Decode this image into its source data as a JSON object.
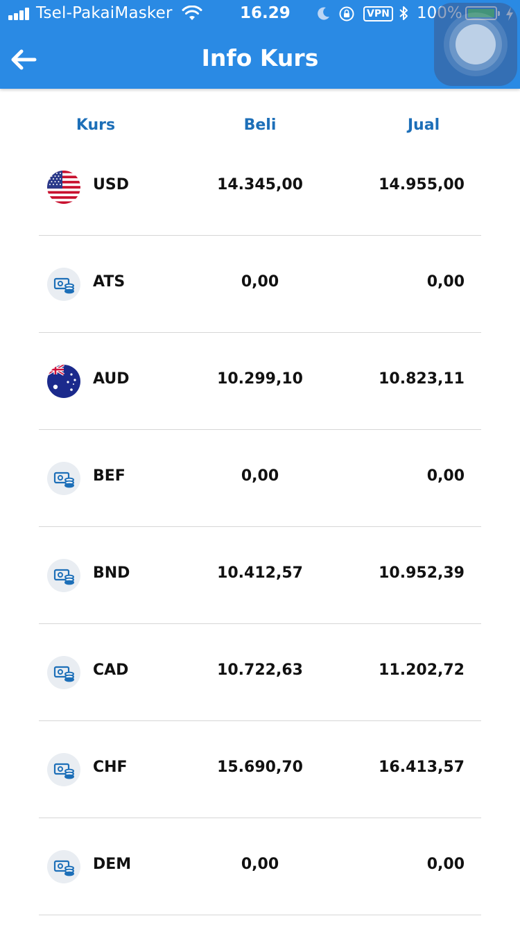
{
  "status_bar": {
    "carrier": "Tsel-PakaiMasker",
    "time": "16.29",
    "vpn_label": "VPN",
    "battery_percent": "100%",
    "battery_level": 1.0
  },
  "nav": {
    "title": "Info Kurs"
  },
  "table": {
    "headers": {
      "kurs": "Kurs",
      "beli": "Beli",
      "jual": "Jual"
    },
    "rows": [
      {
        "code": "USD",
        "beli": "14.345,00",
        "jual": "14.955,00",
        "icon": "us-flag-icon"
      },
      {
        "code": "ATS",
        "beli": "0,00",
        "jual": "0,00",
        "icon": "money-icon"
      },
      {
        "code": "AUD",
        "beli": "10.299,10",
        "jual": "10.823,11",
        "icon": "au-flag-icon"
      },
      {
        "code": "BEF",
        "beli": "0,00",
        "jual": "0,00",
        "icon": "money-icon"
      },
      {
        "code": "BND",
        "beli": "10.412,57",
        "jual": "10.952,39",
        "icon": "money-icon"
      },
      {
        "code": "CAD",
        "beli": "10.722,63",
        "jual": "11.202,72",
        "icon": "money-icon"
      },
      {
        "code": "CHF",
        "beli": "15.690,70",
        "jual": "16.413,57",
        "icon": "money-icon"
      },
      {
        "code": "DEM",
        "beli": "0,00",
        "jual": "0,00",
        "icon": "money-icon"
      }
    ]
  },
  "colors": {
    "nav_background": "#2a8ae4",
    "header_text": "#1d6fb8",
    "money_icon": "#1d6fb8"
  }
}
